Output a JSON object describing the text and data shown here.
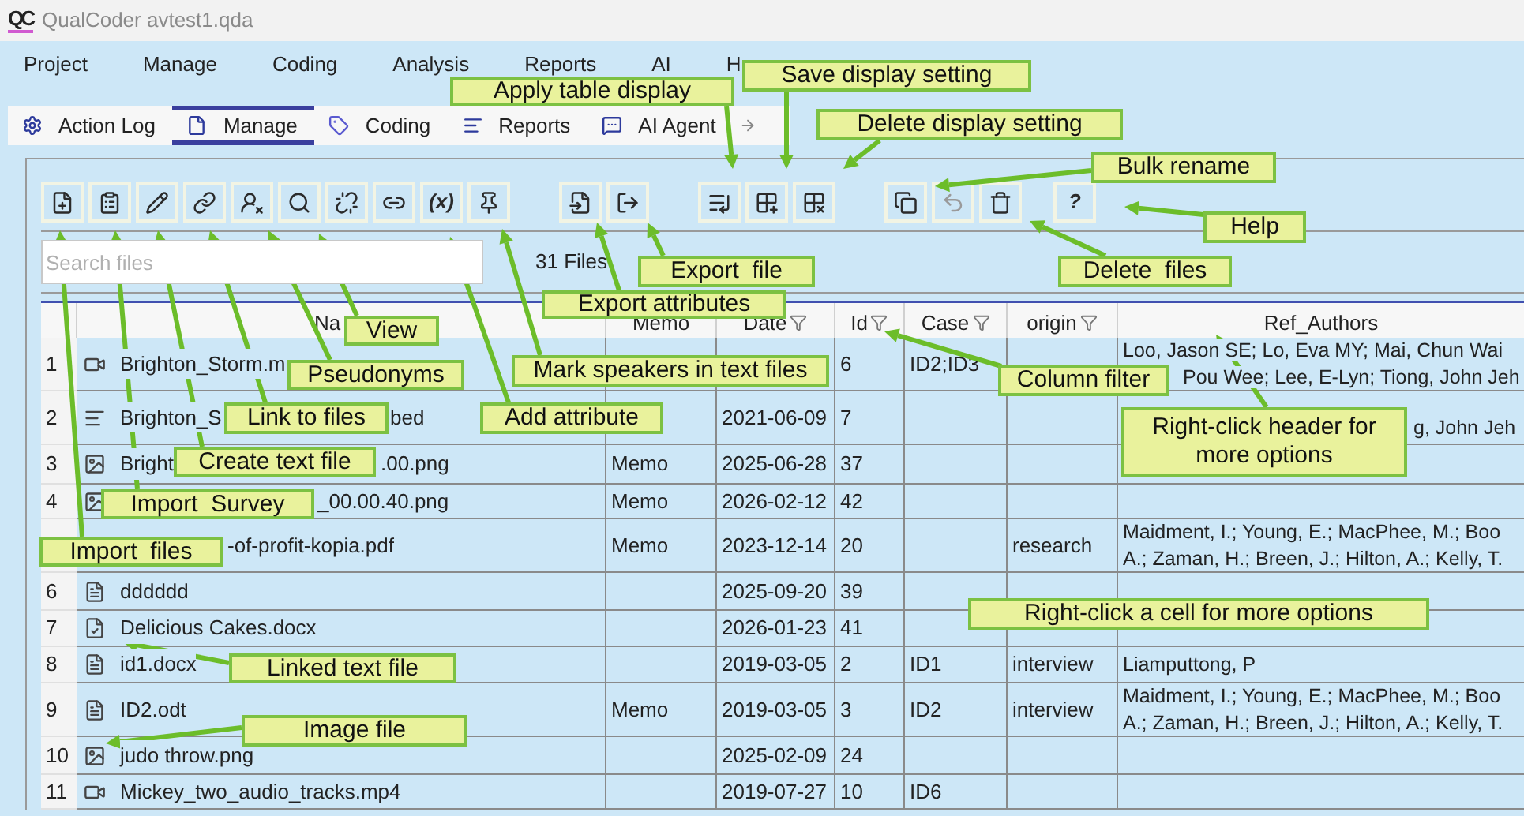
{
  "window": {
    "logo": "QC",
    "title": "QualCoder avtest1.qda"
  },
  "menu": [
    "Project",
    "Manage",
    "Coding",
    "Analysis",
    "Reports",
    "AI",
    "H"
  ],
  "tabs": [
    {
      "label": "Action Log",
      "selected": false
    },
    {
      "label": "Manage",
      "selected": true
    },
    {
      "label": "Coding",
      "selected": false
    },
    {
      "label": "Reports",
      "selected": false
    },
    {
      "label": "AI Agent",
      "selected": false
    }
  ],
  "toolbar": [
    [
      {
        "kind": "import_file",
        "disabled": false
      },
      {
        "kind": "survey",
        "disabled": false
      },
      {
        "kind": "pencil",
        "disabled": false
      },
      {
        "kind": "link",
        "disabled": false
      },
      {
        "kind": "pseudonym",
        "disabled": false
      },
      {
        "kind": "search",
        "disabled": false
      },
      {
        "kind": "unlink",
        "disabled": false
      },
      {
        "kind": "link_plus",
        "disabled": false
      },
      {
        "kind": "text",
        "label": "(x)",
        "disabled": false
      },
      {
        "kind": "pin",
        "disabled": false
      }
    ],
    [
      {
        "kind": "file_export",
        "disabled": false
      },
      {
        "kind": "export",
        "disabled": false
      }
    ],
    [
      {
        "kind": "table_apply",
        "disabled": false
      },
      {
        "kind": "table_add",
        "disabled": false
      },
      {
        "kind": "table_remove",
        "disabled": false
      }
    ],
    [
      {
        "kind": "copy",
        "disabled": false
      },
      {
        "kind": "undo",
        "disabled": true
      },
      {
        "kind": "trash",
        "disabled": false
      }
    ],
    [
      {
        "kind": "text",
        "label": "?",
        "disabled": false
      }
    ]
  ],
  "search": {
    "placeholder": "Search files"
  },
  "file_count": "31 Files",
  "table": {
    "columns": [
      {
        "filter": false
      },
      {
        "label": "Na",
        "filter": false
      },
      {
        "label": "Memo",
        "filter": false
      },
      {
        "label": "Date",
        "filter": true
      },
      {
        "label": "Id",
        "filter": true
      },
      {
        "label": "Case",
        "filter": true
      },
      {
        "label": "origin",
        "filter": true
      },
      {
        "label": "Ref_Authors",
        "filter": false
      }
    ],
    "rows": [
      {
        "num": "1",
        "kind": "video",
        "name": "Brighton_Storm.m",
        "id": "6",
        "case": "ID2;ID3",
        "authors": [
          "Loo, Jason SE; Lo, Eva MY; Mai, Chun Wai",
          "Pou Wee; Lee, E-Lyn; Tiong, John Jeh"
        ]
      },
      {
        "num": "2",
        "kind": "transcript",
        "name": "Brighton_S",
        "name_tail": "bed",
        "date": "2021-06-09",
        "id": "7",
        "authors": [
          "g, John Jeh"
        ]
      },
      {
        "num": "3",
        "kind": "image",
        "name": "Bright",
        "name_tail": ".00.png",
        "memo": "Memo",
        "date": "2025-06-28",
        "id": "37"
      },
      {
        "num": "4",
        "kind": "image",
        "name_tail": "_00.00.40.png",
        "memo": "Memo",
        "date": "2026-02-12",
        "id": "42"
      },
      {
        "name_tail": "-of-profit-kopia.pdf",
        "memo": "Memo",
        "date": "2023-12-14",
        "id": "20",
        "origin": "research",
        "authors": [
          "Maidment, I.; Young, E.; MacPhee, M.; Boo",
          "A.; Zaman, H.; Breen, J.; Hilton, A.; Kelly, T."
        ]
      },
      {
        "num": "6",
        "kind": "text",
        "name": "dddddd",
        "date": "2025-09-20",
        "id": "39"
      },
      {
        "num": "7",
        "kind": "linked_text",
        "name": "Delicious Cakes.docx",
        "date": "2026-01-23",
        "id": "41"
      },
      {
        "num": "8",
        "kind": "text",
        "name": "id1.docx",
        "date": "2019-03-05",
        "id": "2",
        "case": "ID1",
        "origin": "interview",
        "authors": [
          "Liamputtong, P"
        ]
      },
      {
        "num": "9",
        "kind": "text",
        "name": "ID2.odt",
        "memo": "Memo",
        "date": "2019-03-05",
        "id": "3",
        "case": "ID2",
        "origin": "interview",
        "authors": [
          "Maidment, I.; Young, E.; MacPhee, M.; Boo",
          "A.; Zaman, H.; Breen, J.; Hilton, A.; Kelly, T."
        ]
      },
      {
        "num": "10",
        "kind": "image",
        "name": "judo throw.png",
        "date": "2025-02-09",
        "id": "24"
      },
      {
        "num": "11",
        "kind": "video",
        "name": "Mickey_two_audio_tracks.mp4",
        "date": "2019-07-27",
        "id": "10",
        "case": "ID6"
      }
    ]
  },
  "callouts": [
    "Save display setting",
    "Apply table display",
    "Delete display setting",
    "Bulk rename",
    "Help",
    "Export  file",
    "Delete  files",
    "Export attributes",
    "View",
    "Pseudonyms",
    "Mark speakers in text files",
    "Column filter",
    "Link to files",
    "Add attribute",
    "Create text file",
    "Right-click header for more options",
    "Import  Survey",
    "Import  files",
    "Right-click a cell for more options",
    "Linked text file",
    "Image file"
  ]
}
